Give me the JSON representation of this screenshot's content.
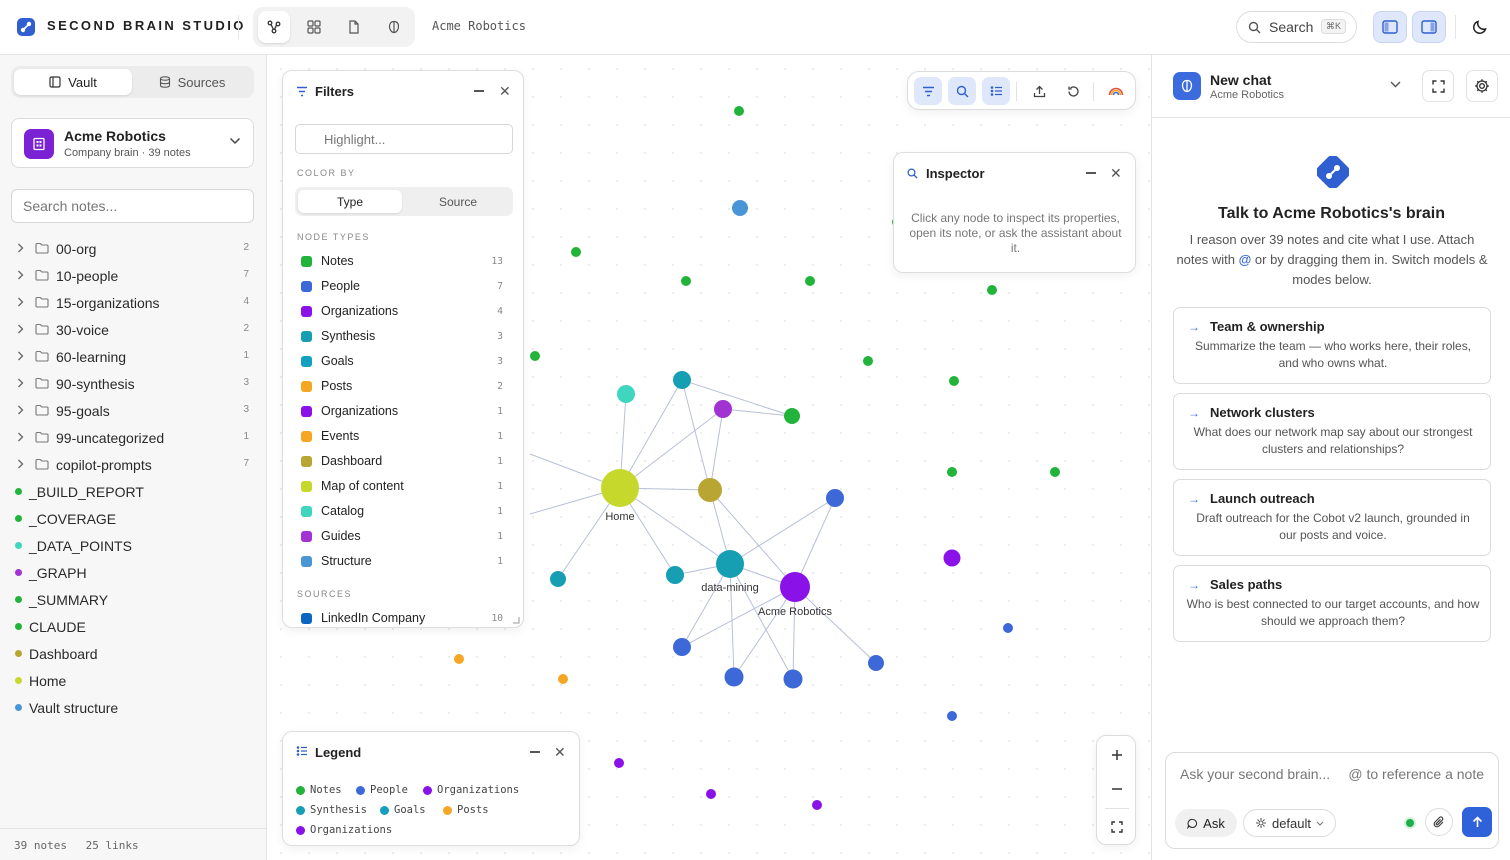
{
  "app": {
    "title": "SECOND BRAIN STUDIO",
    "workspace": "Acme Robotics",
    "search_label": "Search",
    "search_shortcut": "⌘K",
    "view_icons": [
      "graph-view-icon",
      "grid-view-icon",
      "document-view-icon",
      "brain-view-icon"
    ],
    "accent_color": "#3b6bdc"
  },
  "sidebar": {
    "tabs": [
      "Vault",
      "Sources"
    ],
    "active_tab": "Vault",
    "vault": {
      "name": "Acme Robotics",
      "subtitle": "Company brain · 39 notes"
    },
    "search_placeholder": "Search notes...",
    "folders": [
      {
        "name": "00-org",
        "count": "2"
      },
      {
        "name": "10-people",
        "count": "7"
      },
      {
        "name": "15-organizations",
        "count": "4"
      },
      {
        "name": "30-voice",
        "count": "2"
      },
      {
        "name": "60-learning",
        "count": "1"
      },
      {
        "name": "90-synthesis",
        "count": "3"
      },
      {
        "name": "95-goals",
        "count": "3"
      },
      {
        "name": "99-uncategorized",
        "count": "1"
      },
      {
        "name": "copilot-prompts",
        "count": "7"
      }
    ],
    "files": [
      {
        "name": "_BUILD_REPORT",
        "color": "#22b33a"
      },
      {
        "name": "_COVERAGE",
        "color": "#22b33a"
      },
      {
        "name": "_DATA_POINTS",
        "color": "#3fd6c0"
      },
      {
        "name": "_GRAPH",
        "color": "#a033d1"
      },
      {
        "name": "_SUMMARY",
        "color": "#22b33a"
      },
      {
        "name": "CLAUDE",
        "color": "#22b33a"
      },
      {
        "name": "Dashboard",
        "color": "#b9a532"
      },
      {
        "name": "Home",
        "color": "#c7d82c"
      },
      {
        "name": "Vault structure",
        "color": "#4a95d6"
      }
    ],
    "footer": {
      "notes": "39 notes",
      "links": "25 links"
    }
  },
  "filters": {
    "title": "Filters",
    "highlight_placeholder": "Highlight...",
    "color_by_label": "COLOR BY",
    "color_by_options": [
      "Type",
      "Source"
    ],
    "color_by_active": "Type",
    "node_types_label": "NODE TYPES",
    "node_types": [
      {
        "label": "Notes",
        "count": "13",
        "color": "#22b33a"
      },
      {
        "label": "People",
        "count": "7",
        "color": "#3d68d8"
      },
      {
        "label": "Organizations",
        "count": "4",
        "color": "#8a12e8"
      },
      {
        "label": "Synthesis",
        "count": "3",
        "color": "#169fb3"
      },
      {
        "label": "Goals",
        "count": "3",
        "color": "#139fc0"
      },
      {
        "label": "Posts",
        "count": "2",
        "color": "#f5a623"
      },
      {
        "label": "Organizations",
        "count": "1",
        "color": "#8a12e8"
      },
      {
        "label": "Events",
        "count": "1",
        "color": "#f5a623"
      },
      {
        "label": "Dashboard",
        "count": "1",
        "color": "#b9a532"
      },
      {
        "label": "Map of content",
        "count": "1",
        "color": "#c7d82c"
      },
      {
        "label": "Catalog",
        "count": "1",
        "color": "#3fd6c0"
      },
      {
        "label": "Guides",
        "count": "1",
        "color": "#a033d1"
      },
      {
        "label": "Structure",
        "count": "1",
        "color": "#4a95d6"
      }
    ],
    "sources_label": "SOURCES",
    "sources": [
      {
        "label": "LinkedIn Company",
        "count": "10",
        "color": "#0a66c2"
      }
    ]
  },
  "inspector": {
    "title": "Inspector",
    "body": "Click any node to inspect its properties, open its note, or ask the assistant about it."
  },
  "legend": {
    "title": "Legend",
    "items": [
      {
        "label": "Notes",
        "color": "#22b33a"
      },
      {
        "label": "People",
        "color": "#3d68d8"
      },
      {
        "label": "Organizations",
        "color": "#8a12e8"
      },
      {
        "label": "Synthesis",
        "color": "#169fb3"
      },
      {
        "label": "Goals",
        "color": "#139fc0"
      },
      {
        "label": "Posts",
        "color": "#f5a623"
      },
      {
        "label": "Organizations",
        "color": "#8a12e8"
      }
    ]
  },
  "graph": {
    "labels": {
      "home": "Home",
      "data_mining": "data-mining",
      "acme": "Acme Robotics"
    },
    "toolbar_icons": [
      "filter-icon",
      "search-icon",
      "legend-icon",
      "export-icon",
      "reset-icon",
      "rainbow-icon"
    ],
    "zoom_icons": [
      "zoom-in-icon",
      "zoom-out-icon",
      "fit-screen-icon"
    ]
  },
  "chat": {
    "title": "New chat",
    "subtitle": "Acme Robotics",
    "heading": "Talk to Acme Robotics's brain",
    "intro_before": "I reason over 39 notes and cite what I use. Attach notes with ",
    "intro_at": "@",
    "intro_after": " or by dragging them in. Switch models & modes below.",
    "prompts": [
      {
        "title": "Team & ownership",
        "desc": "Summarize the team — who works here, their roles, and who owns what."
      },
      {
        "title": "Network clusters",
        "desc": "What does our network map say about our strongest clusters and relationships?"
      },
      {
        "title": "Launch outreach",
        "desc": "Draft outreach for the Cobot v2 launch, grounded in our posts and voice."
      },
      {
        "title": "Sales paths",
        "desc": "Who is best connected to our target accounts, and how should we approach them?"
      }
    ],
    "composer": {
      "placeholder": "Ask your second brain...",
      "reference_hint": "@ to reference a note",
      "mode": "Ask",
      "model": "default"
    }
  }
}
